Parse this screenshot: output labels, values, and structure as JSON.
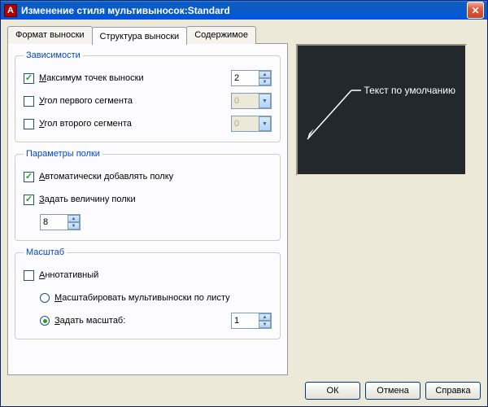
{
  "title": "Изменение стиля мультивыносок:Standard",
  "tabs": [
    "Формат выноски",
    "Структура выноски",
    "Содержимое"
  ],
  "groups": {
    "constraints": {
      "legend": "Зависимости",
      "maxPoints": {
        "label_u": "М",
        "label": "аксимум точек выноски",
        "value": "2",
        "checked": true
      },
      "firstSeg": {
        "label_u": "У",
        "label": "гол первого сегмента",
        "value": "0",
        "checked": false
      },
      "secondSeg": {
        "label_u": "У",
        "label": "гол второго сегмента",
        "value": "0",
        "checked": false
      }
    },
    "shelf": {
      "legend": "Параметры полки",
      "autoShelf": {
        "label_u": "А",
        "label": "втоматически добавлять полку",
        "checked": true
      },
      "setLength": {
        "label_u": "З",
        "label": "адать величину полки",
        "checked": true
      },
      "length": "8"
    },
    "scale": {
      "legend": "Масштаб",
      "annotative": {
        "label_u": "А",
        "label": "ннотативный",
        "checked": false
      },
      "byLayout": {
        "label_u": "М",
        "label": "асштабировать мультивыноски по листу",
        "selected": false
      },
      "setScale": {
        "label_u": "З",
        "label": "адать масштаб:",
        "selected": true
      },
      "scale": "1"
    }
  },
  "preview": {
    "text": "Текст по умолчанию"
  },
  "buttons": {
    "ok": "ОК",
    "cancel": "Отмена",
    "help": "Справка"
  }
}
